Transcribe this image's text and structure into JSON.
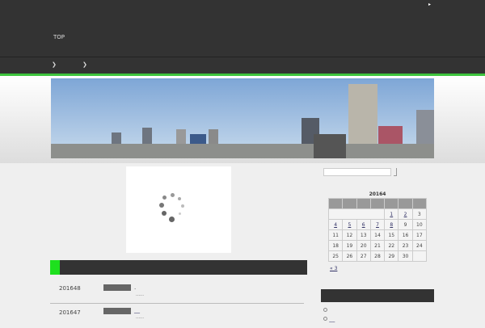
{
  "header": {
    "nav_top": "TOP",
    "corner_icon": "play-icon"
  },
  "nav": {
    "items": [
      "❯",
      "❯"
    ]
  },
  "colors": {
    "accent": "#3ec43e",
    "dark": "#333333"
  },
  "search": {
    "value": "",
    "placeholder": ""
  },
  "calendar": {
    "caption": "20164",
    "rows": [
      [
        "",
        "",
        "",
        "",
        "1",
        "2",
        "3"
      ],
      [
        "4",
        "5",
        "6",
        "7",
        "8",
        "9",
        "10"
      ],
      [
        "11",
        "12",
        "13",
        "14",
        "15",
        "16",
        "17"
      ],
      [
        "18",
        "19",
        "20",
        "21",
        "22",
        "23",
        "24"
      ],
      [
        "25",
        "26",
        "27",
        "28",
        "29",
        "30",
        ""
      ]
    ],
    "links": [
      "1",
      "2",
      "4",
      "5",
      "6",
      "7",
      "8"
    ],
    "prev": "« 3"
  },
  "posts": [
    {
      "date": "201648",
      "title": ".",
      "excerpt": "……"
    },
    {
      "date": "201647",
      "title": "__",
      "excerpt": "……"
    }
  ],
  "sidebar_list": [
    "",
    "__"
  ]
}
